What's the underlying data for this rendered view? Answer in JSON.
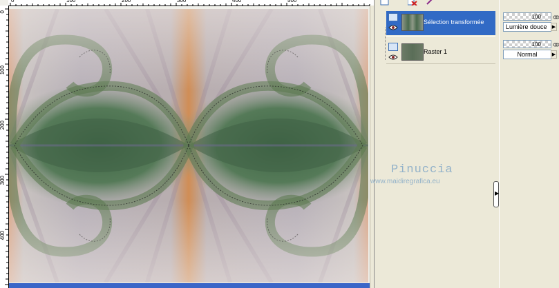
{
  "canvas": {
    "ruler_top_labels": [
      "0",
      "100",
      "200",
      "300",
      "400",
      "500"
    ],
    "ruler_left_labels": [
      "0",
      "100",
      "200",
      "300",
      "400"
    ]
  },
  "layers": {
    "items": [
      {
        "name": "Sélection transformée",
        "selected": true,
        "visible": true,
        "opacity": "100",
        "blend_mode": "Lumière douce"
      },
      {
        "name": "Raster 1",
        "selected": false,
        "visible": true,
        "opacity": "100",
        "blend_mode": "Normal"
      }
    ]
  },
  "watermark": {
    "name": "Pinuccia",
    "url": "www.maidiregrafica.eu"
  },
  "colors": {
    "selection_blue": "#316ac5",
    "panel_bg": "#ece9d8",
    "watermark": "#93b2c9",
    "scrollbar": "#3a66c8"
  },
  "icons": [
    "new-layer-icon",
    "delete-layer-icon",
    "properties-icon",
    "layer-type-icon",
    "eye-icon",
    "chevron-right-icon",
    "chain-icon"
  ]
}
